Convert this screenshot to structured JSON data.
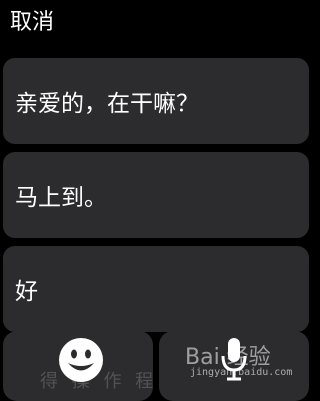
{
  "header": {
    "cancel_label": "取消"
  },
  "replies": [
    {
      "text": "亲爱的，在干嘛？"
    },
    {
      "text": "马上到。"
    },
    {
      "text": "好"
    }
  ],
  "bottom_bar": {
    "emoji_icon": "smiley-face-icon",
    "dictation_icon": "microphone-icon"
  },
  "watermark": {
    "title": "Bai 经验",
    "url": "jingyan.baidu.com",
    "faint_text": "得 操 作 程"
  }
}
